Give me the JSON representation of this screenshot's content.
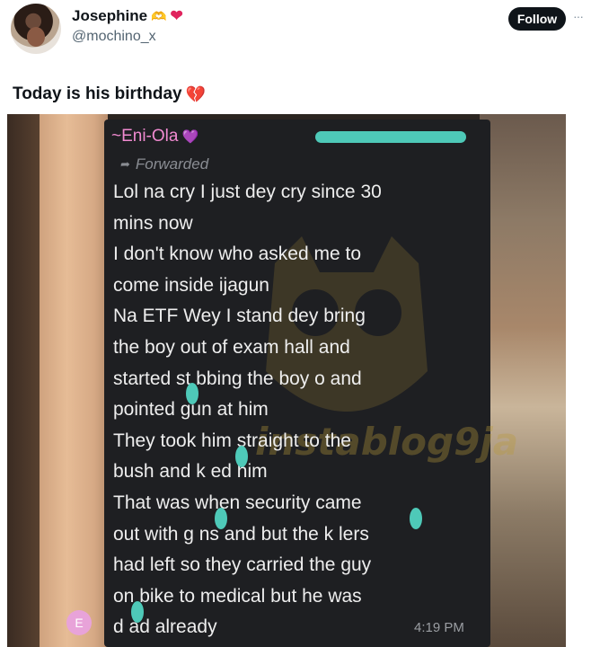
{
  "post": {
    "display_name": "Josephine",
    "name_emoji_1": "🫶",
    "name_emoji_2": "❤",
    "handle": "@mochino_x",
    "follow_label": "Follow",
    "more_label": "···",
    "text": "Today is his birthday",
    "text_emoji": "💔"
  },
  "image": {
    "sender": "~Eni-Ola",
    "sender_emoji": "💜",
    "forwarded_label": "Forwarded",
    "forwarded_icon": "forward-arrow-icon",
    "message_lines": [
      "Lol na cry I just dey cry since 30",
      "mins now",
      "I don't know who asked me to",
      "come inside ijagun",
      "Na ETF Wey I stand dey bring",
      "the boy out of exam hall and",
      "started st  bbing the boy o and",
      "pointed gun at him",
      "They took him straight to the",
      "bush and k  ed him",
      "That was when security came",
      "out with g  ns and but the k  lers",
      "had left so they carried the guy",
      "on bike to medical but he was",
      "d  ad already"
    ],
    "time": "4:19 PM",
    "avatar_letter": "E",
    "watermark": "instablog9ja",
    "redaction_color": "#4ec9b8"
  },
  "colors": {
    "follow_bg": "#0f1419",
    "handle_text": "#536471",
    "sender_pink": "#f08ad0"
  }
}
